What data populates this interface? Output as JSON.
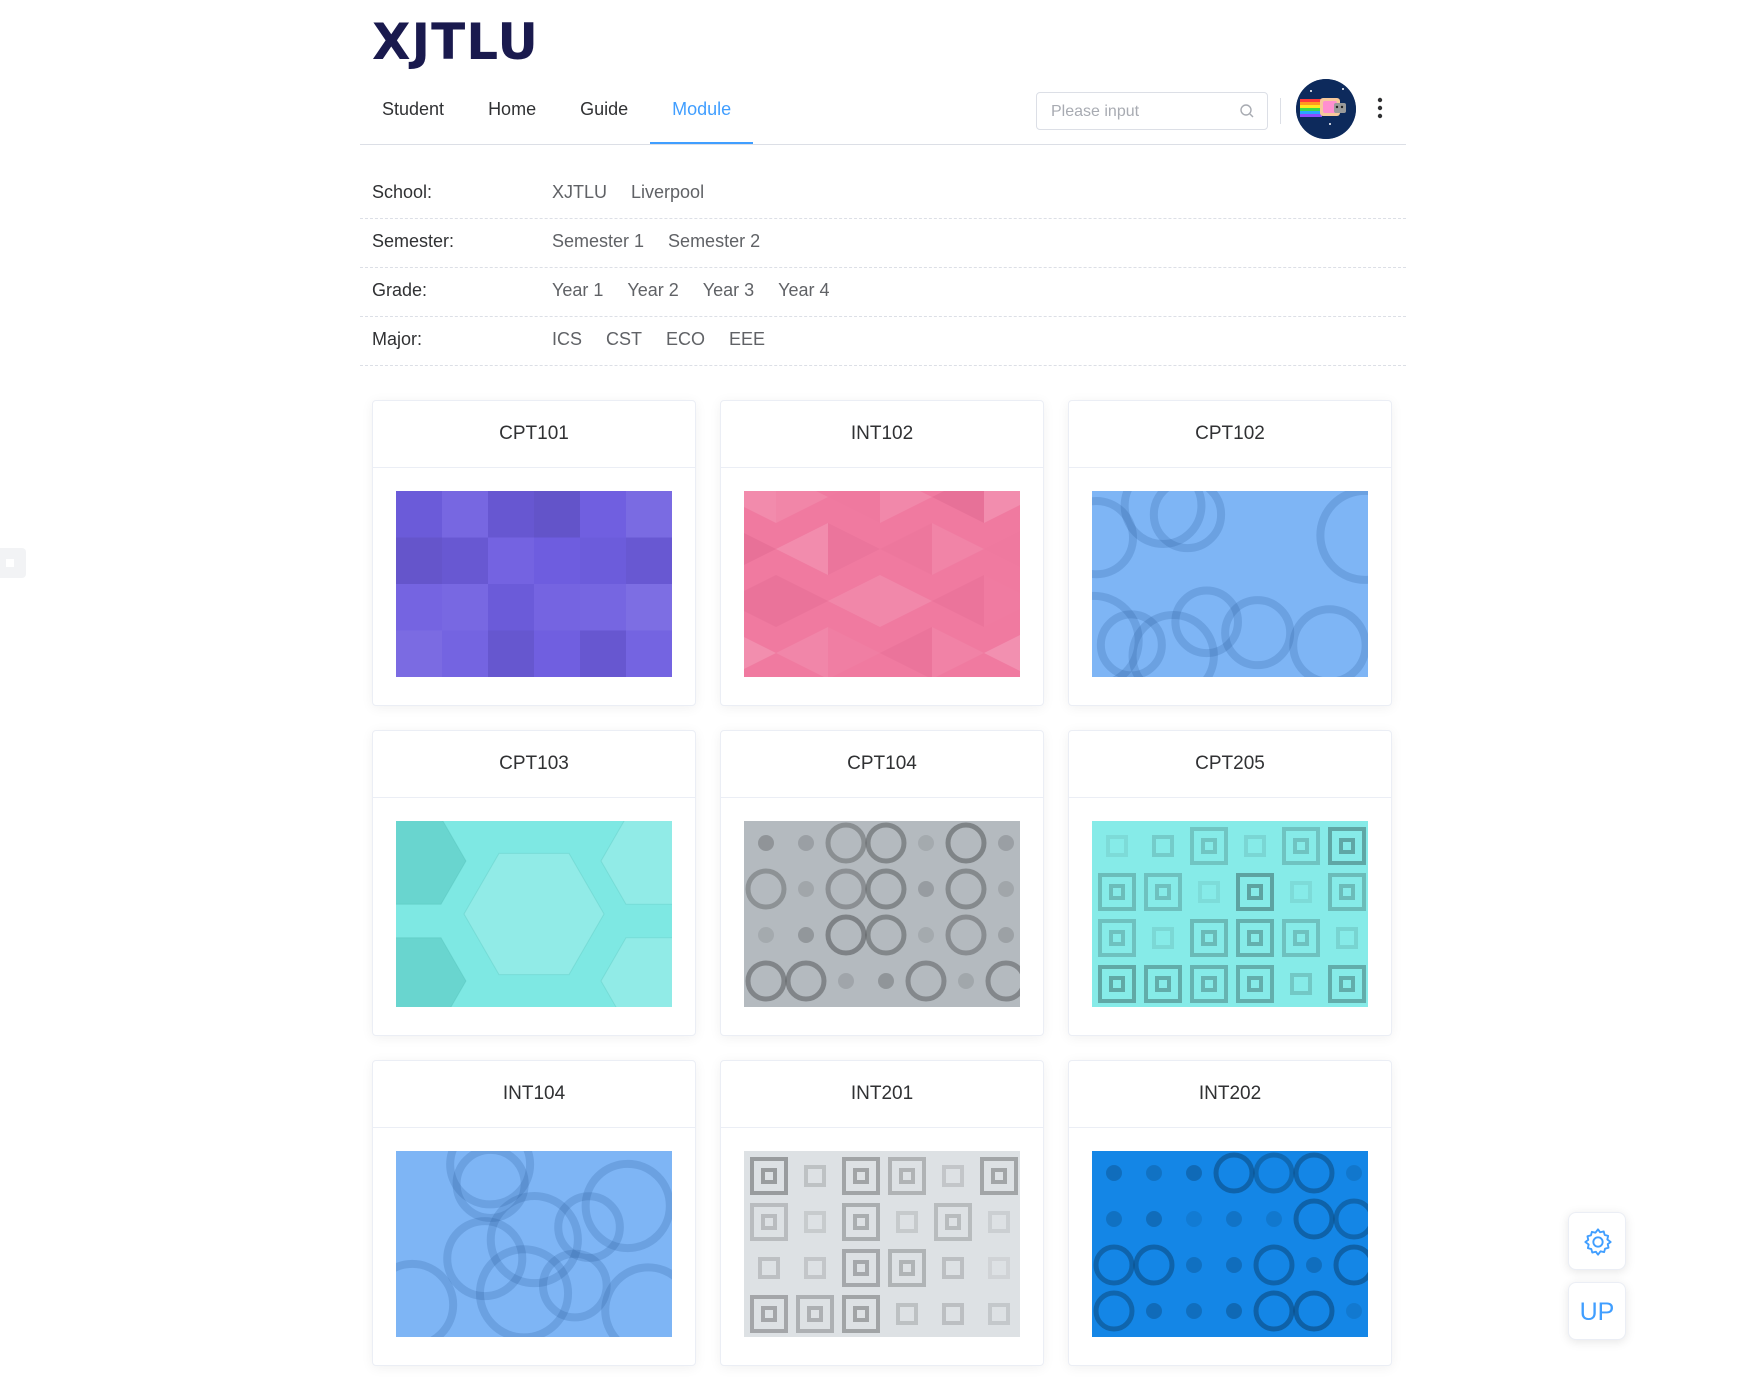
{
  "brand": {
    "logo_text": "XJTLU"
  },
  "nav": {
    "tabs": [
      {
        "label": "Student"
      },
      {
        "label": "Home"
      },
      {
        "label": "Guide"
      },
      {
        "label": "Module",
        "active": true
      }
    ],
    "search": {
      "placeholder": "Please input",
      "value": ""
    },
    "accent_color": "#409eff"
  },
  "filters": {
    "school": {
      "label": "School:",
      "options": [
        "XJTLU",
        "Liverpool"
      ]
    },
    "semester": {
      "label": "Semester:",
      "options": [
        "Semester 1",
        "Semester 2"
      ]
    },
    "grade": {
      "label": "Grade:",
      "options": [
        "Year 1",
        "Year 2",
        "Year 3",
        "Year 4"
      ]
    },
    "major": {
      "label": "Major:",
      "options": [
        "ICS",
        "CST",
        "ECO",
        "EEE"
      ]
    }
  },
  "modules": [
    {
      "code": "CPT101",
      "pattern": "squares",
      "color": "#6f5ee0"
    },
    {
      "code": "INT102",
      "pattern": "triangles",
      "color": "#f07aa0"
    },
    {
      "code": "CPT102",
      "pattern": "rings",
      "color": "#7eb5f5"
    },
    {
      "code": "CPT103",
      "pattern": "hexagons",
      "color": "#7ee8e3"
    },
    {
      "code": "CPT104",
      "pattern": "circles",
      "color": "#b4babf"
    },
    {
      "code": "CPT205",
      "pattern": "nested-squares",
      "color": "#86ebe8"
    },
    {
      "code": "INT104",
      "pattern": "rings",
      "color": "#7eb5f5"
    },
    {
      "code": "INT201",
      "pattern": "nested-squares",
      "color": "#dde1e4"
    },
    {
      "code": "INT202",
      "pattern": "circles",
      "color": "#1486e6"
    }
  ],
  "floating": {
    "settings_icon": "gear-icon",
    "up_label": "UP"
  }
}
